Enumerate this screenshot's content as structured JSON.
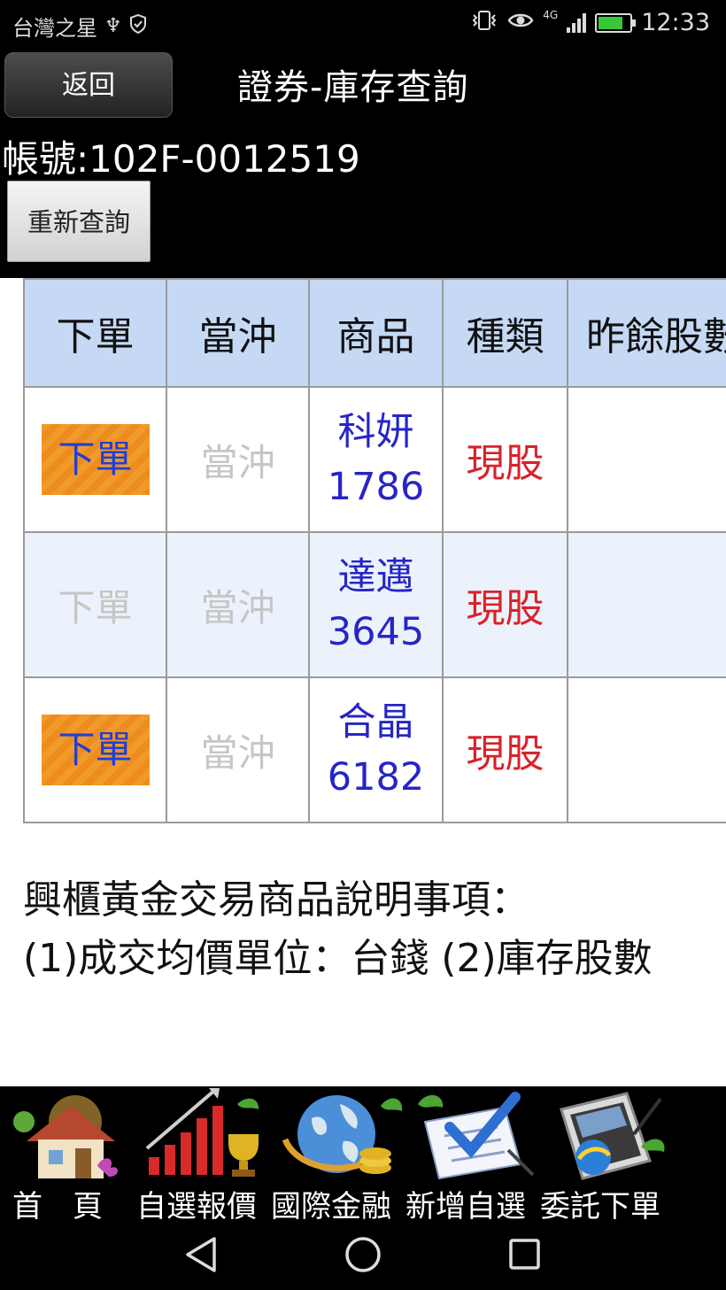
{
  "status_bar": {
    "carrier": "台灣之星",
    "network": "4G",
    "time": "12:33",
    "battery_level": 0.8
  },
  "header": {
    "back_label": "返回",
    "title": "證券-庫存查詢",
    "account": "帳號:102F-0012519",
    "requery_label": "重新查詢"
  },
  "table": {
    "columns": [
      "下單",
      "當沖",
      "商品",
      "種類",
      "昨餘股數"
    ],
    "rows": [
      {
        "order": "下單",
        "order_enabled": true,
        "daytrade": "當沖",
        "name": "科妍",
        "code": "1786",
        "type": "現股"
      },
      {
        "order": "下單",
        "order_enabled": false,
        "daytrade": "當沖",
        "name": "達邁",
        "code": "3645",
        "type": "現股"
      },
      {
        "order": "下單",
        "order_enabled": true,
        "daytrade": "當沖",
        "name": "合晶",
        "code": "6182",
        "type": "現股"
      }
    ]
  },
  "notes": {
    "title": "興櫃黃金交易商品說明事項：",
    "line1": "(1)成交均價單位：台錢 (2)庫存股數"
  },
  "bottom_nav": {
    "items": [
      {
        "label": "首　頁",
        "icon": "home-icon"
      },
      {
        "label": "自選報價",
        "icon": "chart-trophy-icon"
      },
      {
        "label": "國際金融",
        "icon": "globe-coins-icon"
      },
      {
        "label": "新增自選",
        "icon": "checklist-icon"
      },
      {
        "label": "委託下單",
        "icon": "tablet-order-icon"
      }
    ]
  },
  "colors": {
    "header_bg": "#000000",
    "table_header_bg": "#c5d9f5",
    "order_button": "#f19a2c",
    "product_text": "#2525c8",
    "type_text": "#d8222a"
  }
}
